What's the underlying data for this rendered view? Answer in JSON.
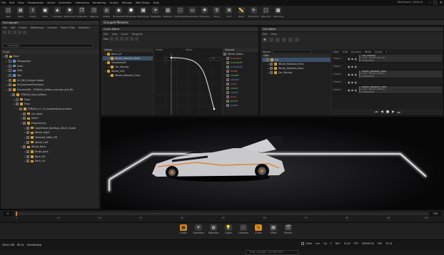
{
  "menubar": {
    "items": [
      "File",
      "Edit",
      "View",
      "Visualization",
      "Scene",
      "Animation",
      "Interaction",
      "Rendering",
      "Scripts",
      "Window",
      "Web Shops",
      "Help"
    ],
    "workspace": "Workspace: Default",
    "win_min": "–",
    "win_max": "□",
    "win_close": "✕"
  },
  "toolbar": {
    "items": [
      {
        "label": "New",
        "icon": "new-icon",
        "glyph": "▢"
      },
      {
        "label": "Open",
        "icon": "open-icon",
        "glyph": "▤"
      },
      {
        "label": "Import",
        "icon": "import-icon",
        "glyph": "⇩"
      },
      {
        "label": "Save",
        "icon": "save-icon",
        "glyph": "▣"
      },
      {
        "label": "Antialias",
        "icon": "antialias-icon",
        "glyph": "◈"
      },
      {
        "label": "Raytracing",
        "icon": "raytracing-icon",
        "glyph": "✺"
      },
      {
        "label": "Duplicate",
        "icon": "duplicate-icon",
        "glyph": "❐"
      },
      {
        "label": "Regroup",
        "icon": "regroup-icon",
        "glyph": "⬡"
      },
      {
        "label": "Isolate",
        "icon": "isolate-icon",
        "glyph": "◎"
      },
      {
        "label": "Screenshot",
        "icon": "screenshot-icon",
        "glyph": "◉"
      },
      {
        "label": "Wireframe",
        "icon": "wireframe-icon",
        "glyph": "⬢"
      },
      {
        "label": "Boundings",
        "icon": "boundings-icon",
        "glyph": "▦"
      },
      {
        "label": "Headlight",
        "icon": "headlight-icon",
        "glyph": "☀"
      },
      {
        "label": "Statistics",
        "icon": "statistics-icon",
        "glyph": "▥"
      },
      {
        "label": "Fullscreen",
        "icon": "fullscreen-icon",
        "glyph": "⛶"
      },
      {
        "label": "Presentation",
        "icon": "presentation-icon",
        "glyph": "▭"
      },
      {
        "label": "Show All",
        "icon": "show-all-icon",
        "glyph": "✥"
      },
      {
        "label": "Zoom",
        "icon": "zoom-icon",
        "glyph": "⚲"
      },
      {
        "label": "Unit",
        "icon": "unit-icon",
        "glyph": "⊞"
      },
      {
        "label": "Ruler",
        "icon": "ruler-icon",
        "glyph": "📏"
      },
      {
        "label": "Transform",
        "icon": "transform-icon",
        "glyph": "✛"
      },
      {
        "label": "Selection",
        "icon": "selection-icon",
        "glyph": "⬚"
      },
      {
        "label": "Texturing",
        "icon": "texturing-icon",
        "glyph": "▩"
      }
    ]
  },
  "scenegraph": {
    "title": "Scenegraph",
    "menu": [
      "File",
      "Edit",
      "Create",
      "References",
      "Convert",
      "Show / Hide",
      "Selection"
    ],
    "search_placeholder": "Scenegraph",
    "root_label": "Graph",
    "tree": [
      {
        "label": "Root",
        "indent": 0,
        "type": "g",
        "checked": true
      },
      {
        "label": "Perspective",
        "indent": 1,
        "type": "b",
        "checked": false
      },
      {
        "label": "Front",
        "indent": 1,
        "type": "b",
        "checked": false
      },
      {
        "label": "Side",
        "indent": 1,
        "type": "b",
        "checked": false
      },
      {
        "label": "Top",
        "indent": 1,
        "type": "b",
        "checked": false
      },
      {
        "label": "02_ENV_Simple Studio",
        "indent": 1,
        "type": "g",
        "checked": true
      },
      {
        "label": "EnvironmentTransform",
        "indent": 1,
        "type": "g",
        "checked": true
      },
      {
        "label": "Sunshine00 - STRAXX_LeMans_concept_and_Re",
        "indent": 1,
        "type": "g",
        "checked": true
      },
      {
        "label": "STRAXX_final_LeMans",
        "indent": 2,
        "type": "g",
        "checked": true
      },
      {
        "label": "Floor",
        "indent": 3,
        "type": "g",
        "checked": false
      },
      {
        "label": "Final",
        "indent": 3,
        "type": "g",
        "checked": true
      },
      {
        "label": "STRAXX_v7_13_Accelerated_surfaces",
        "indent": 4,
        "type": "g",
        "checked": true
      },
      {
        "label": "Car_body",
        "indent": 5,
        "type": "g",
        "checked": true
      },
      {
        "label": "Rails7",
        "indent": 5,
        "type": "g",
        "checked": true
      },
      {
        "label": "Engineering",
        "indent": 5,
        "type": "g",
        "checked": true
      },
      {
        "label": "Sub(Wheel_NewTopo_08-01_2)odd",
        "indent": 6,
        "type": "g",
        "checked": true
      },
      {
        "label": "Wheel_Right",
        "indent": 6,
        "type": "g",
        "checked": true
      },
      {
        "label": "Sidewalk_Wear_RH",
        "indent": 6,
        "type": "g",
        "checked": true
      },
      {
        "label": "Wheel_Left",
        "indent": 6,
        "type": "g",
        "checked": true
      },
      {
        "label": "Wheel_Back",
        "indent": 5,
        "type": "g",
        "checked": true
      },
      {
        "label": "Brake_back",
        "indent": 6,
        "type": "g",
        "checked": true
      },
      {
        "label": "Back_RH",
        "indent": 6,
        "type": "g",
        "checked": true
      },
      {
        "label": "Back_LH",
        "indent": 6,
        "type": "g",
        "checked": true
      }
    ]
  },
  "grouped_modules": {
    "title": "Grouped Modules"
  },
  "curve_editor": {
    "title": "Curve Editor",
    "menu": [
      "Edit",
      "View",
      "Curve",
      "Tangents"
    ],
    "prev_label": "Prev",
    "frame_label": "Frame",
    "frame_value": "0",
    "value_label": "Value",
    "value_value": "1.00",
    "library_header": "Library",
    "library": [
      {
        "label": "Back_LH",
        "indent": 0,
        "sel": false
      },
      {
        "label": "Wheel_Rotation_Back",
        "indent": 1,
        "sel": true
      },
      {
        "label": "Transform00",
        "indent": 0,
        "sel": false
      },
      {
        "label": "Car_Moving",
        "indent": 1,
        "sel": false
      },
      {
        "label": "Wheel_Left",
        "indent": 0,
        "sel": false
      },
      {
        "label": "Wheel_Rotation_Front",
        "indent": 1,
        "sel": false
      }
    ],
    "channel_header": "Channel",
    "channel_group": "Wheel_Rotat...",
    "channels": [
      "translate",
      "translateY",
      "translateZ",
      "rotate",
      "rotateY",
      "rotateZ",
      "scale",
      "scaleY",
      "scaleZ",
      "pivot",
      "pivotY",
      "pivotZ"
    ]
  },
  "clip_maker": {
    "title": "Clip Maker",
    "menu": [
      "Edit",
      "View"
    ],
    "wizard_label": "Wizard",
    "clips_header": "Clips",
    "start_label": "Start",
    "start_value": "0.00",
    "duration_label": "Duration",
    "duration_value": "96.00",
    "cycles_label": "Cycles",
    "cycles_value": "1",
    "clips": [
      {
        "label": "Car",
        "indent": 0,
        "sel": true
      },
      {
        "label": "Wheel_Rotation_Front",
        "indent": 1,
        "sel": false
      },
      {
        "label": "Wheel_Rotation_Back",
        "indent": 1,
        "sel": false
      },
      {
        "label": "Car_Moving",
        "indent": 1,
        "sel": false
      }
    ],
    "tracks": [
      {
        "name": "Track 1",
        "clip": "Car_Moving",
        "time": "0.00 - 96.00 (96.00)",
        "mode": "MotionBlur"
      },
      {
        "name": "Track 2",
        "clip": "",
        "time": "",
        "mode": ""
      },
      {
        "name": "Track 3",
        "clip": "Wheel_Rotation_Back",
        "time": "0.00 - 96.00 (96.00)",
        "mode": "MotionBlur"
      },
      {
        "name": "Track 4",
        "clip": "",
        "time": "",
        "mode": ""
      },
      {
        "name": "Track 5",
        "clip": "Wheel_Rotation_Front",
        "time": "0.00 - 96.00 (96.00)",
        "mode": "MotionBlur"
      }
    ]
  },
  "timeline": {
    "start": "0",
    "end": "100",
    "ticks": [
      "0",
      "10",
      "20",
      "30",
      "40",
      "50",
      "60",
      "70",
      "80",
      "90",
      "100"
    ],
    "current": "0"
  },
  "bottombar": {
    "items": [
      {
        "label": "Graph",
        "icon": "graph-icon",
        "glyph": "▦",
        "active": true
      },
      {
        "label": "Transform",
        "icon": "transform-icon",
        "glyph": "✛",
        "active": false
      },
      {
        "label": "Materials",
        "icon": "materials-icon",
        "glyph": "◍",
        "active": false
      },
      {
        "label": "Lights",
        "icon": "lights-icon",
        "glyph": "💡",
        "active": false
      },
      {
        "label": "Cameras",
        "icon": "cameras-icon",
        "glyph": "🎥",
        "active": false
      },
      {
        "label": "Curve",
        "icon": "curve-icon",
        "glyph": "∿",
        "active": true
      },
      {
        "label": "VSets",
        "icon": "vsets-icon",
        "glyph": "▤",
        "active": false
      },
      {
        "label": "Render",
        "icon": "render-icon",
        "glyph": "🎬",
        "active": false
      }
    ]
  },
  "statusbar": {
    "memory": "3924.0 MB",
    "renderer": "RR-GL",
    "window": "MainWindow",
    "cmd_placeholder": "Enter Command - ALT+RETURN",
    "units_label": "Units",
    "units_value": "mm",
    "up_label": "Up",
    "up_value": "Z",
    "ncp_label": "NCP",
    "ncp_value": "10.00",
    "fcp_label": "FCP",
    "fcp_value": "500000.00",
    "fov_label": "FOV",
    "fov_value": "35.24"
  }
}
